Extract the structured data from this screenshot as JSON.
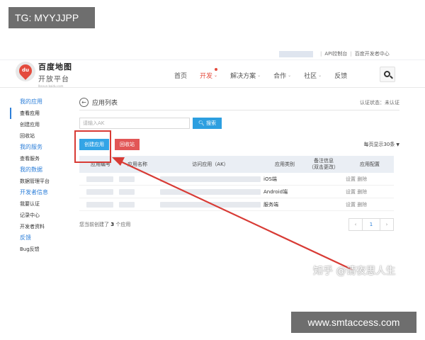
{
  "badge_tg": "TG: MYYJJPP",
  "badge_site": "www.smtaccess.com",
  "watermark": "知乎 @请夜思人生",
  "top_links": [
    "API控制台",
    "百度开发者中心"
  ],
  "logo": {
    "title": "百度地图",
    "subtitle": "开放平台",
    "url": "lbsyun.baidu.com"
  },
  "nav": [
    {
      "label": "首页",
      "chevron": ""
    },
    {
      "label": "开发",
      "chevron": "⌄"
    },
    {
      "label": "解决方案",
      "chevron": "⌄"
    },
    {
      "label": "合作",
      "chevron": "⌄"
    },
    {
      "label": "社区",
      "chevron": "⌄"
    },
    {
      "label": "反馈",
      "chevron": ""
    }
  ],
  "sidebar": {
    "sections": [
      {
        "title": "我的应用",
        "items": [
          "查看应用",
          "创建应用",
          "回收站"
        ]
      },
      {
        "title": "我的服务",
        "items": [
          "查看服务"
        ]
      },
      {
        "title": "我的数据",
        "items": [
          "数据管理平台"
        ]
      },
      {
        "title": "开发者信息",
        "items": [
          "我要认证",
          "记录中心",
          "开发者资料"
        ]
      },
      {
        "title": "反馈",
        "items": [
          "Bug反馈"
        ]
      }
    ]
  },
  "main": {
    "title": "应用列表",
    "auth_status": "认证状态：未认证",
    "search_placeholder": "请输入AK",
    "search_button": "搜索",
    "create_button": "创建应用",
    "recycle_button": "回收站",
    "per_page": "每页显示30条",
    "table": {
      "headers": [
        "应用编号",
        "应用名称",
        "访问应用（AK）",
        "应用类别",
        "备注信息\n（双击更改）",
        "应用配置"
      ],
      "rows": [
        {
          "category": "iOS端",
          "config": "设置 删除"
        },
        {
          "category": "Android端",
          "config": "设置 删除"
        },
        {
          "category": "服务端",
          "config": "设置 删除"
        }
      ]
    },
    "count_prefix": "您当前创建了",
    "count": "3",
    "count_suffix": "个应用",
    "pager": {
      "prev": "‹",
      "page": "1",
      "next": "›"
    }
  },
  "colors": {
    "accent_blue": "#2d7fd9",
    "brand_red": "#e44b3d",
    "annotation_red": "#d83b35"
  }
}
